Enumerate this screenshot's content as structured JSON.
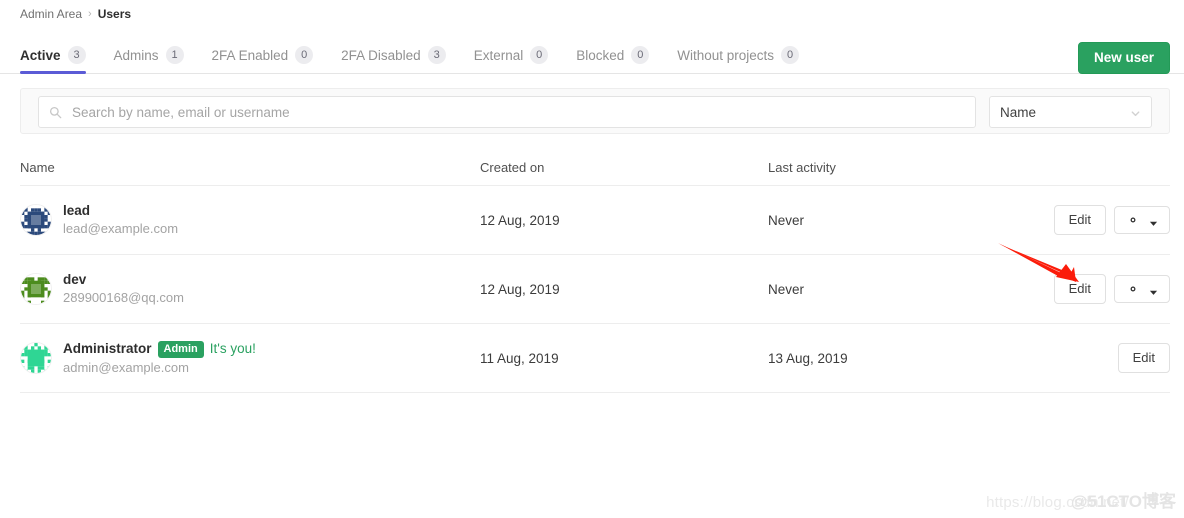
{
  "breadcrumb": {
    "parent": "Admin Area",
    "separator": "›",
    "current": "Users"
  },
  "tabs": [
    {
      "label": "Active",
      "count": "3",
      "active": true
    },
    {
      "label": "Admins",
      "count": "1",
      "active": false
    },
    {
      "label": "2FA Enabled",
      "count": "0",
      "active": false
    },
    {
      "label": "2FA Disabled",
      "count": "3",
      "active": false
    },
    {
      "label": "External",
      "count": "0",
      "active": false
    },
    {
      "label": "Blocked",
      "count": "0",
      "active": false
    },
    {
      "label": "Without projects",
      "count": "0",
      "active": false
    }
  ],
  "actions": {
    "new_user_label": "New user"
  },
  "search": {
    "placeholder": "Search by name, email or username",
    "value": "",
    "icon": "search-icon"
  },
  "sort": {
    "selected": "Name",
    "icon": "chevron-down-icon"
  },
  "table": {
    "headers": {
      "name": "Name",
      "created": "Created on",
      "activity": "Last activity"
    },
    "rows": [
      {
        "name": "lead",
        "email": "lead@example.com",
        "created": "12 Aug, 2019",
        "activity": "Never",
        "badge": "",
        "its_you": "",
        "avatar_color": "#2c4a7c",
        "edit_label": "Edit",
        "has_gear_menu": true
      },
      {
        "name": "dev",
        "email": "289900168@qq.com",
        "created": "12 Aug, 2019",
        "activity": "Never",
        "badge": "",
        "its_you": "",
        "avatar_color": "#4c8c1e",
        "edit_label": "Edit",
        "has_gear_menu": true
      },
      {
        "name": "Administrator",
        "email": "admin@example.com",
        "created": "11 Aug, 2019",
        "activity": "13 Aug, 2019",
        "badge": "Admin",
        "its_you": "It's you!",
        "avatar_color": "#2fd694",
        "edit_label": "Edit",
        "has_gear_menu": false
      }
    ]
  },
  "colors": {
    "accent_green": "#2aa160",
    "active_tab_underline": "#5b5bd6",
    "annotation_arrow": "#fb1c0a",
    "badge_bg": "#ececef"
  },
  "annotation": {
    "type": "arrow",
    "points_to": "edit-button-row-2"
  },
  "watermark": {
    "url": "https://blog.csdn.net/",
    "handle": "@51CTO博客"
  }
}
